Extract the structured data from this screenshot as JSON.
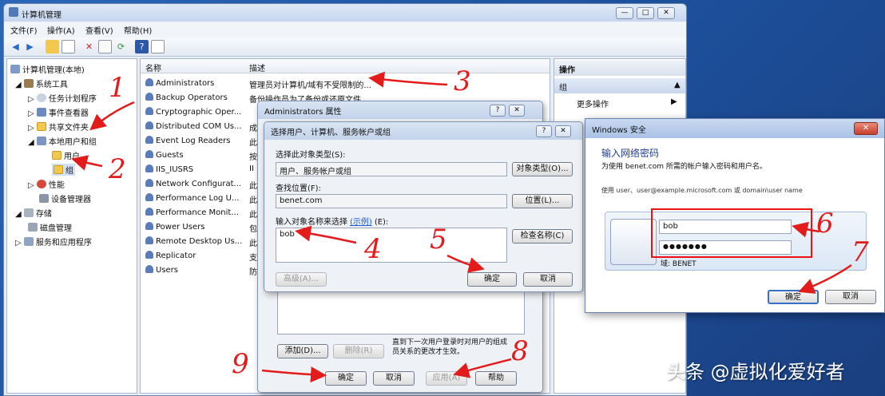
{
  "window": {
    "title": "计算机管理"
  },
  "menubar": {
    "items": [
      "文件(F)",
      "操作(A)",
      "查看(V)",
      "帮助(H)"
    ]
  },
  "tree": {
    "root": "计算机管理(本地)",
    "items": [
      "系统工具",
      "任务计划程序",
      "事件查看器",
      "共享文件夹",
      "本地用户和组",
      "用户",
      "组",
      "性能",
      "设备管理器",
      "存储",
      "磁盘管理",
      "服务和应用程序"
    ]
  },
  "list": {
    "headers": [
      "名称",
      "描述"
    ],
    "rows": [
      {
        "name": "Administrators",
        "desc": "管理员对计算机/域有不受限制的..."
      },
      {
        "name": "Backup Operators",
        "desc": "备份操作员为了备份或还原文件..."
      },
      {
        "name": "Cryptographic Oper...",
        "desc": ""
      },
      {
        "name": "Distributed COM Us...",
        "desc": "成"
      },
      {
        "name": "Event Log Readers",
        "desc": "此"
      },
      {
        "name": "Guests",
        "desc": "按"
      },
      {
        "name": "IIS_IUSRS",
        "desc": "II"
      },
      {
        "name": "Network Configurat...",
        "desc": "此"
      },
      {
        "name": "Performance Log U...",
        "desc": "此"
      },
      {
        "name": "Performance Monit...",
        "desc": "此"
      },
      {
        "name": "Power Users",
        "desc": "包"
      },
      {
        "name": "Remote Desktop Us...",
        "desc": "此"
      },
      {
        "name": "Replicator",
        "desc": "支"
      },
      {
        "name": "Users",
        "desc": "防"
      }
    ]
  },
  "actions": {
    "header": "操作",
    "section": "组",
    "more": "更多操作"
  },
  "props_dialog": {
    "title": "Administrators 属性",
    "description": "直到下一次用户登录时对用户的组成员关系的更改才生效。",
    "buttons": {
      "add": "添加(D)...",
      "remove": "删除(R)",
      "ok": "确定",
      "cancel": "取消",
      "apply": "应用(A)",
      "help": "帮助"
    }
  },
  "select_dialog": {
    "title": "选择用户、计算机、服务帐户或组",
    "object_type_label": "选择此对象类型(S):",
    "object_type_value": "用户、服务帐户或组",
    "object_type_button": "对象类型(O)...",
    "location_label": "查找位置(F):",
    "location_value": "benet.com",
    "location_button": "位置(L)...",
    "names_label": "输入对象名称来选择",
    "names_link": "(示例)",
    "names_label_suffix": "(E):",
    "names_value": "bob",
    "check_button": "检查名称(C)",
    "advanced_button": "高级(A)...",
    "ok": "确定",
    "cancel": "取消"
  },
  "security_dialog": {
    "title": "Windows 安全",
    "close": "✕",
    "heading": "输入网络密码",
    "subtitle": "为使用 benet.com 所需的帐户输入密码和用户名。",
    "hint": "使用 user、user@example.microsoft.com 或 domain\\user name",
    "username": "bob",
    "password": "●●●●●●●",
    "domain": "域: BENET",
    "ok": "确定",
    "cancel": "取消"
  },
  "annotations": [
    "1",
    "2",
    "3",
    "4",
    "5",
    "6",
    "7",
    "8",
    "9"
  ],
  "watermark": "头条 @虚拟化爱好者",
  "colors": {
    "annotation": "#e31b1b",
    "desktop": "#1d4f9a",
    "titlebar": "#c6d6ee"
  }
}
